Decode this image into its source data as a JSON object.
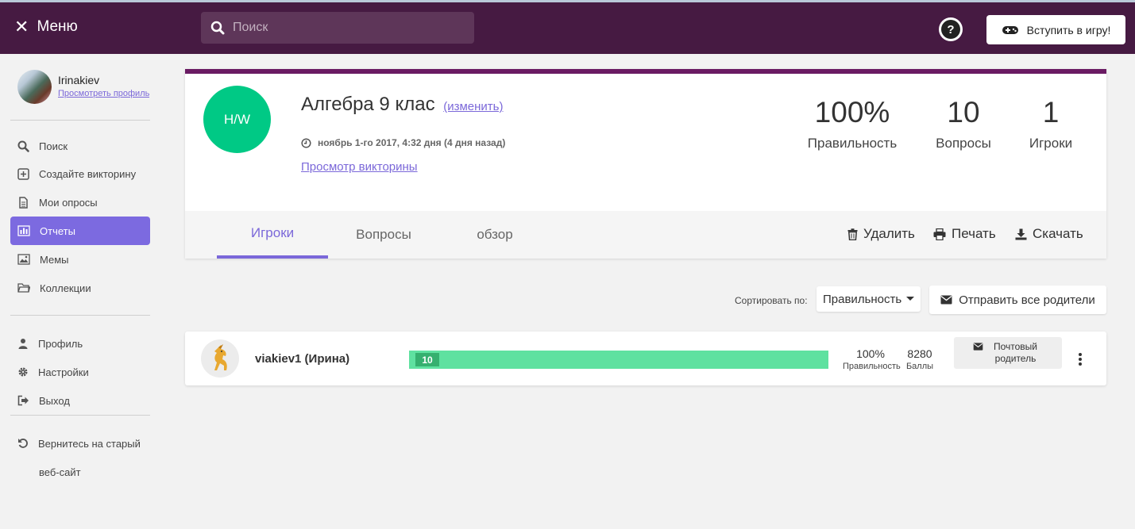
{
  "header": {
    "menu_label": "Меню",
    "search_placeholder": "Поиск",
    "help_label": "?",
    "join_game_label": "Вступить в игру!"
  },
  "sidebar": {
    "user": {
      "name": "Irinakiev",
      "profile_link": "Просмотреть профиль"
    },
    "items": [
      {
        "label": "Поиск",
        "icon": "search-icon"
      },
      {
        "label": "Создайте викторину",
        "icon": "plus-square-icon"
      },
      {
        "label": "Мои опросы",
        "icon": "document-icon"
      },
      {
        "label": "Отчеты",
        "icon": "bar-chart-icon",
        "active": true
      },
      {
        "label": "Мемы",
        "icon": "image-icon"
      },
      {
        "label": "Коллекции",
        "icon": "folder-icon"
      }
    ],
    "account_items": [
      {
        "label": "Профиль",
        "icon": "user-icon"
      },
      {
        "label": "Настройки",
        "icon": "gear-icon"
      },
      {
        "label": "Выход",
        "icon": "sign-out-icon"
      }
    ],
    "old_site": {
      "line1": "Вернитесь на старый",
      "line2": "веб-сайт",
      "icon": "undo-icon"
    }
  },
  "quiz": {
    "badge": "H/W",
    "title": "Алгебра 9 клас",
    "change_label": "(изменить)",
    "date": "ноябрь 1-го 2017, 4:32 дня (4 дня назад)",
    "view_link": "Просмотр викторины",
    "stats": {
      "accuracy": {
        "value": "100%",
        "label": "Правильность"
      },
      "questions": {
        "value": "10",
        "label": "Вопросы"
      },
      "players": {
        "value": "1",
        "label": "Игроки"
      }
    },
    "tabs": [
      {
        "label": "Игроки",
        "active": true
      },
      {
        "label": "Вопросы"
      },
      {
        "label": "обзор"
      }
    ],
    "actions": {
      "delete": "Удалить",
      "print": "Печать",
      "download": "Скачать"
    }
  },
  "sort": {
    "label": "Сортировать по:",
    "selected": "Правильность",
    "send_all": "Отправить все родители"
  },
  "players": [
    {
      "name": "viakiev1 (Ирина)",
      "correct_count": "10",
      "progress_fraction": 1.0,
      "accuracy": {
        "value": "100%",
        "label": "Правильность"
      },
      "score": {
        "value": "8280",
        "label": "Баллы"
      },
      "mail_parent": "Почтовый родитель"
    }
  ],
  "colors": {
    "topbar": "#461a42",
    "accent": "#7c6ae0",
    "badge_green": "#00c985",
    "bar_green": "#5fe1a0",
    "card_border": "#6a1b63"
  }
}
